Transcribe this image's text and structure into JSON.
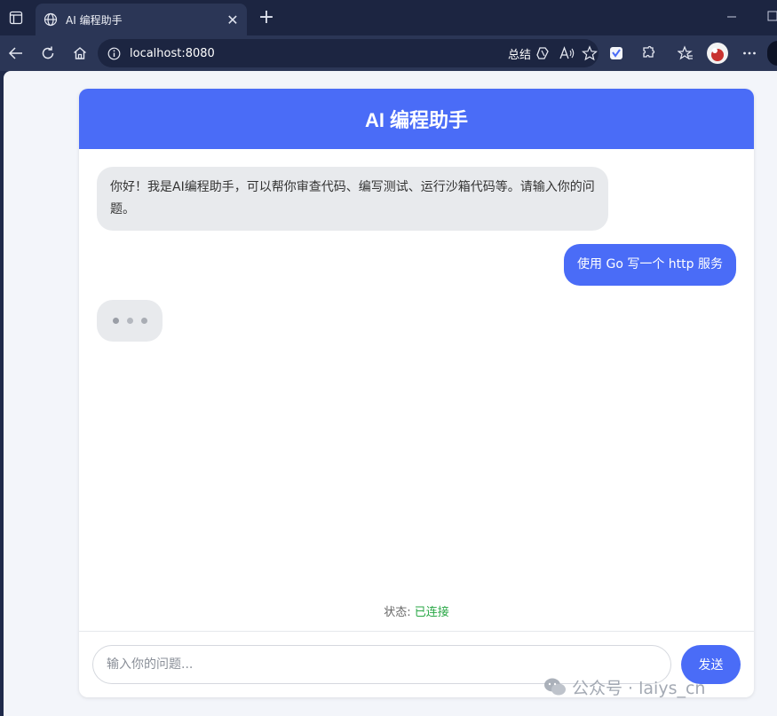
{
  "browser": {
    "tab_title": "AI 编程助手",
    "url": "localhost:8080",
    "summary_label": "总结"
  },
  "chat": {
    "title": "AI 编程助手",
    "messages": [
      {
        "role": "assistant",
        "text": "你好！我是AI编程助手，可以帮你审查代码、编写测试、运行沙箱代码等。请输入你的问题。"
      },
      {
        "role": "user",
        "text": "使用 Go 写一个 http 服务"
      }
    ],
    "status_label": "状态: ",
    "status_value": "已连接",
    "input_placeholder": "输入你的问题...",
    "send_label": "发送"
  },
  "watermark": {
    "text": "公众号 · laiys_cn"
  },
  "colors": {
    "accent": "#4a6cf7",
    "connected": "#28a745",
    "ai_bubble": "#e8eaed"
  }
}
